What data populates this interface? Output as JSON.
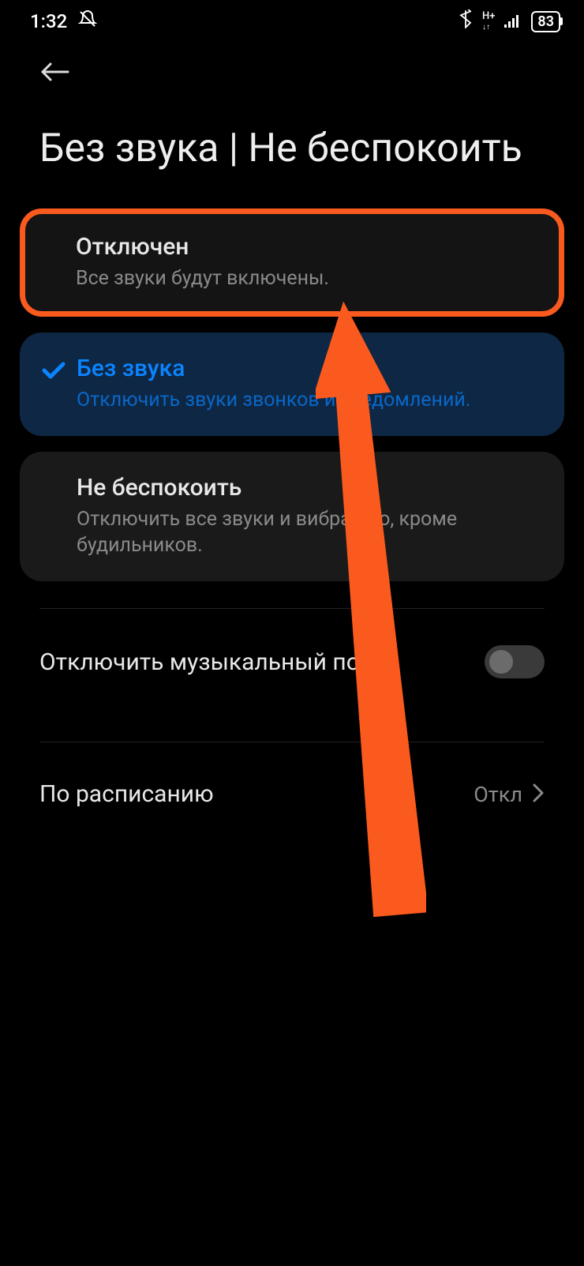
{
  "status": {
    "time": "1:32",
    "battery": "83"
  },
  "page": {
    "title": "Без звука | Не беспокоить"
  },
  "options": [
    {
      "title": "Отключен",
      "sub": "Все звуки будут включены."
    },
    {
      "title": "Без звука",
      "sub": "Отключить звуки звонков и уведомлений."
    },
    {
      "title": "Не беспокоить",
      "sub": "Отключить все звуки и вибрацию, кроме будильников."
    }
  ],
  "settings": {
    "mute_stream": {
      "label": "Отключить музыкальный поток"
    },
    "schedule": {
      "label": "По расписанию",
      "value": "Откл"
    }
  }
}
